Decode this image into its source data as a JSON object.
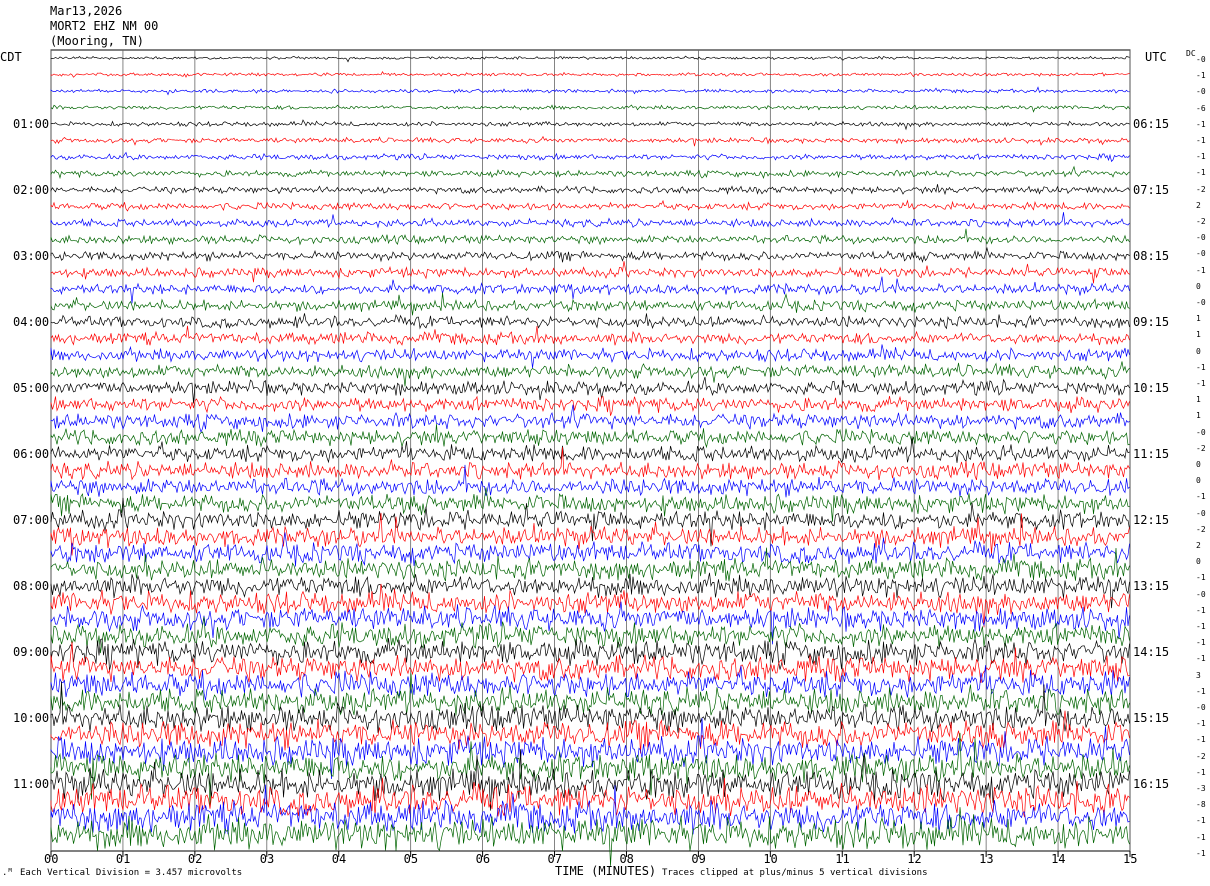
{
  "header": {
    "date": "Mar13,2026",
    "station": "MORT2 EHZ NM 00",
    "location": "(Mooring, TN)"
  },
  "chart_data": {
    "type": "line",
    "title": "MORT2 EHZ NM 00",
    "left_axis_title": "CDT",
    "right_axis_title": "UTC",
    "dc_title": "DC",
    "xlabel": "TIME (MINUTES)",
    "xlim": [
      0,
      15
    ],
    "x_ticks": [
      "00",
      "01",
      "02",
      "03",
      "04",
      "05",
      "06",
      "07",
      "08",
      "09",
      "10",
      "11",
      "12",
      "13",
      "14",
      "15"
    ],
    "left_time_labels": [
      "01:00",
      "02:00",
      "03:00",
      "04:00",
      "05:00",
      "06:00",
      "07:00",
      "08:00",
      "09:00",
      "10:00",
      "11:00"
    ],
    "right_time_labels": [
      "06:15",
      "07:15",
      "08:15",
      "09:15",
      "10:15",
      "11:15",
      "12:15",
      "13:15",
      "14:15",
      "15:15",
      "16:15"
    ],
    "trace_colors": [
      "#000000",
      "#ff0000",
      "#0000ff",
      "#006400"
    ],
    "trace_count": 48,
    "minutes_per_trace": 15,
    "dc_offsets": [
      "-0",
      "-1",
      "-0",
      "-6",
      "-1",
      "-1",
      "-1",
      "-1",
      "-2",
      "2",
      "-2",
      "-0",
      "-0",
      "-1",
      "0",
      "-0",
      "1",
      "1",
      "0",
      "-1",
      "-1",
      "1",
      "1",
      "-0",
      "-2",
      "0",
      "0",
      "-1",
      "-0",
      "-2",
      "2",
      "0",
      "-1",
      "-0",
      "-1",
      "-1",
      "-1",
      "-1",
      "3",
      "-1",
      "-0",
      "-1",
      "-1",
      "-2",
      "-1",
      "-3",
      "-8",
      "-1",
      "-1",
      "-1"
    ],
    "scale_note": "Each Vertical Division =   3.457 microvolts",
    "clip_note": "Traces clipped at plus/minus 5 vertical divisions"
  }
}
